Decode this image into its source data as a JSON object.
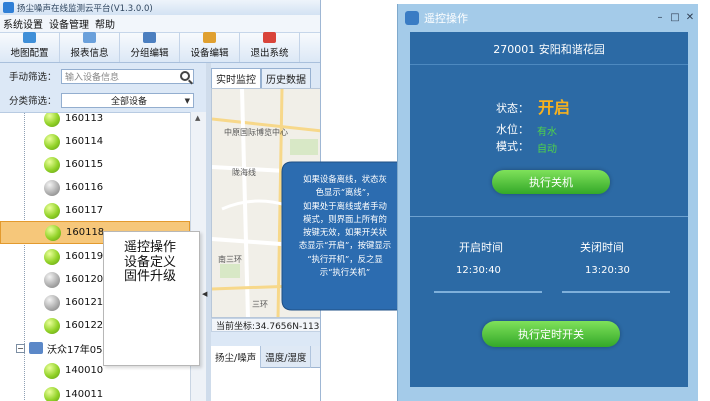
{
  "app": {
    "title": "扬尘噪声在线监测云平台(V1.3.0.0)",
    "menu": [
      "系统设置",
      "设备管理",
      "帮助"
    ],
    "toolbar": [
      {
        "label": "地图配置",
        "icon": "map-config-icon",
        "color": "#3f8fd8"
      },
      {
        "label": "报表信息",
        "icon": "report-icon",
        "color": "#6aa0db"
      },
      {
        "label": "分组编辑",
        "icon": "group-edit-icon",
        "color": "#4c7fc0"
      },
      {
        "label": "设备编辑",
        "icon": "device-edit-icon",
        "color": "#e0a030"
      },
      {
        "label": "退出系统",
        "icon": "exit-icon",
        "color": "#d9443a"
      }
    ],
    "filters": {
      "search_label": "手动筛选：",
      "search_placeholder": "输入设备信息",
      "category_label": "分类筛选：",
      "category_value": "全部设备"
    },
    "devices": [
      {
        "id": "160113",
        "status": "online"
      },
      {
        "id": "160114",
        "status": "online"
      },
      {
        "id": "160115",
        "status": "online"
      },
      {
        "id": "160116",
        "status": "offline"
      },
      {
        "id": "160117",
        "status": "online"
      },
      {
        "id": "160118",
        "status": "selected"
      },
      {
        "id": "160119",
        "status": "online"
      },
      {
        "id": "160120",
        "status": "offline"
      },
      {
        "id": "160121",
        "status": "offline"
      },
      {
        "id": "160122",
        "status": "online"
      }
    ],
    "group": {
      "label": "沃众17年05月"
    },
    "group_devices": [
      {
        "id": "140010",
        "status": "online"
      },
      {
        "id": "140011",
        "status": "online"
      }
    ],
    "context_menu": [
      "遥控操作",
      "设备定义",
      "固件升级"
    ],
    "map_tabs": [
      "实时监控",
      "历史数据"
    ],
    "map_labels": [
      "中原国际博览中心",
      "陇海线",
      "南三环",
      "三环"
    ],
    "coords": "当前坐标:34.7656N-113.",
    "bottom_tabs": [
      "扬尘/噪声",
      "温度/湿度"
    ]
  },
  "callout": {
    "lines": [
      "如果设备离线，状态灰",
      "色显示“离线”，",
      "如果处于离线或者手动",
      "模式，则界面上所有的",
      "按键无效，如果开关状",
      "态显示“开启”，按键显示",
      "“执行开机”，反之显",
      "示“执行关机”"
    ]
  },
  "dialog": {
    "title": "遥控操作",
    "station": "270001 安阳和谐花园",
    "status_label": "状态：",
    "status_value": "开启",
    "water_label": "水位：",
    "water_value": "有水",
    "mode_label": "模式：",
    "mode_value": "自动",
    "execute_button": "执行关机",
    "start_time_label": "开启时间",
    "close_time_label": "关闭时间",
    "start_time": "12:30:40",
    "close_time": "13:20:30",
    "timer_button": "执行定时开关"
  }
}
